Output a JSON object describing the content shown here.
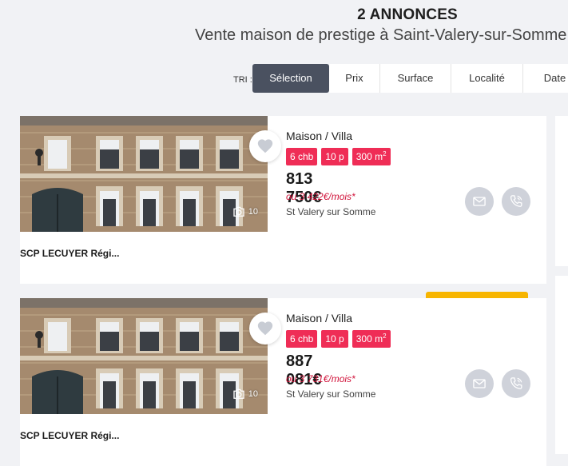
{
  "header": {
    "count": "2 ANNONCES",
    "subtitle": "Vente maison de prestige à Saint-Valery-sur-Somme"
  },
  "sort": {
    "label": "TRI :",
    "options": [
      "Sélection",
      "Prix",
      "Surface",
      "Localité",
      "Date"
    ],
    "active": "Sélection"
  },
  "listings": [
    {
      "type": "Maison / Villa",
      "tags": [
        "6 chb",
        "10 p",
        "300 m"
      ],
      "tag_sup": "2",
      "price": "813 750€",
      "monthly": "ou 3 422€/mois*",
      "location": "St Valery sur Somme",
      "agency": "SCP LECUYER Régi...",
      "photo_count": "10"
    },
    {
      "type": "Maison / Villa",
      "tags": [
        "6 chb",
        "10 p",
        "300 m"
      ],
      "tag_sup": "2",
      "price": "887 081€",
      "monthly": "ou 3 731€/mois*",
      "location": "St Valery sur Somme",
      "agency": "SCP LECUYER Régi...",
      "photo_count": "10"
    }
  ],
  "icons": {
    "favorite": "heart-icon",
    "camera": "camera-icon",
    "mail": "mail-icon",
    "phone": "phone-icon"
  },
  "colors": {
    "tag": "#ef2d56",
    "monthly": "#d1143b",
    "active_sort": "#4a5160",
    "badge": "#f7b500",
    "button_circle": "#cfd2da"
  }
}
